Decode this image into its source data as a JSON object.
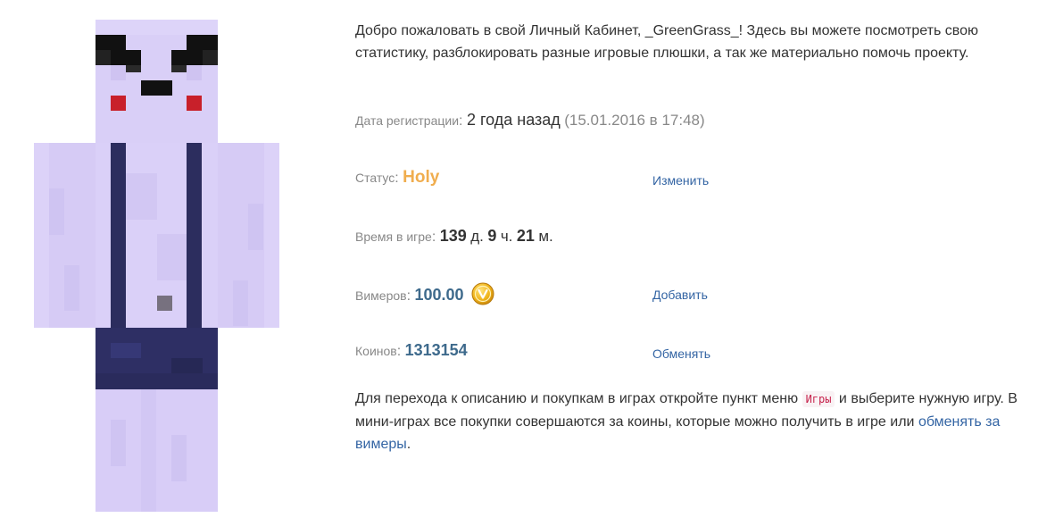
{
  "skin": {
    "alt": "player skin"
  },
  "welcome": {
    "prefix": "Добро пожаловать в свой Личный Кабинет, ",
    "username": "_GreenGrass_",
    "suffix": "! Здесь вы можете посмотреть свою статистику, разблокировать разные игровые плюшки, а так же материально помочь проекту."
  },
  "registration": {
    "label": "Дата регистрации",
    "since": "2 года назад",
    "date": "(15.01.2016 в 17:48)"
  },
  "status": {
    "label": "Статус",
    "value": "Holy",
    "action": "Изменить"
  },
  "playtime": {
    "label": "Время в игре",
    "days": "139",
    "days_unit": "д.",
    "hours": "9",
    "hours_unit": "ч.",
    "minutes": "21",
    "minutes_unit": "м."
  },
  "vimers": {
    "label": "Вимеров",
    "value": "100.00",
    "icon": "gold-coin-icon",
    "action": "Добавить"
  },
  "coins": {
    "label": "Коинов",
    "value": "1313154",
    "action": "Обменять"
  },
  "footer": {
    "text_before": "Для перехода к описанию и покупкам в играх откройте пункт меню ",
    "menu_tag": "Игры",
    "text_middle": " и выберите нужную игру. В мини-играх все покупки совершаются за коины, которые можно получить в игре или ",
    "link": "обменять за вимеры",
    "text_after": "."
  },
  "colors": {
    "status_holy": "#f0ad4e",
    "link": "#3465a4",
    "balance": "#3e6a8c",
    "label": "#888888"
  }
}
